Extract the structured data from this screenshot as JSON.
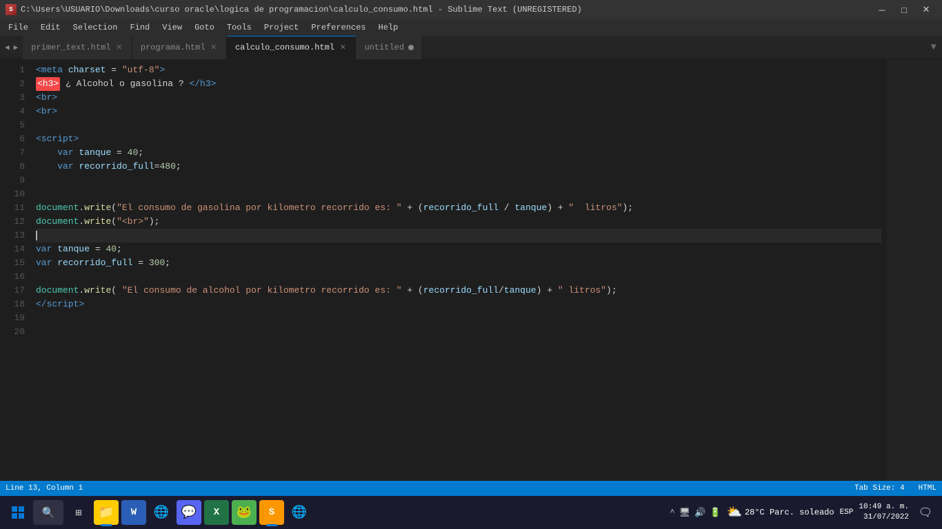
{
  "titleBar": {
    "title": "C:\\Users\\USUARIO\\Downloads\\curso oracle\\logica de programacion\\calculo_consumo.html - Sublime Text (UNREGISTERED)",
    "logo": "S",
    "minimize": "─",
    "maximize": "□",
    "close": "✕"
  },
  "menuBar": {
    "items": [
      "File",
      "Edit",
      "Selection",
      "Find",
      "View",
      "Goto",
      "Tools",
      "Project",
      "Preferences",
      "Help"
    ]
  },
  "tabs": [
    {
      "label": "primer_text.html",
      "active": false,
      "hasClose": true
    },
    {
      "label": "programa.html",
      "active": false,
      "hasClose": true
    },
    {
      "label": "calculo_consumo.html",
      "active": true,
      "hasClose": true
    },
    {
      "label": "untitled",
      "active": false,
      "hasClose": false,
      "hasDot": true
    }
  ],
  "lineNumbers": [
    1,
    2,
    3,
    4,
    5,
    6,
    7,
    8,
    9,
    10,
    11,
    12,
    13,
    14,
    15,
    16,
    17,
    18,
    19,
    20
  ],
  "statusBar": {
    "left": "Line 13, Column 1",
    "tabSize": "Tab Size: 4",
    "language": "HTML"
  },
  "taskbar": {
    "time": "10:49 a. m.",
    "date": "31/07/2022",
    "weather": "28°C  Parc. soleado",
    "language": "ESP"
  }
}
